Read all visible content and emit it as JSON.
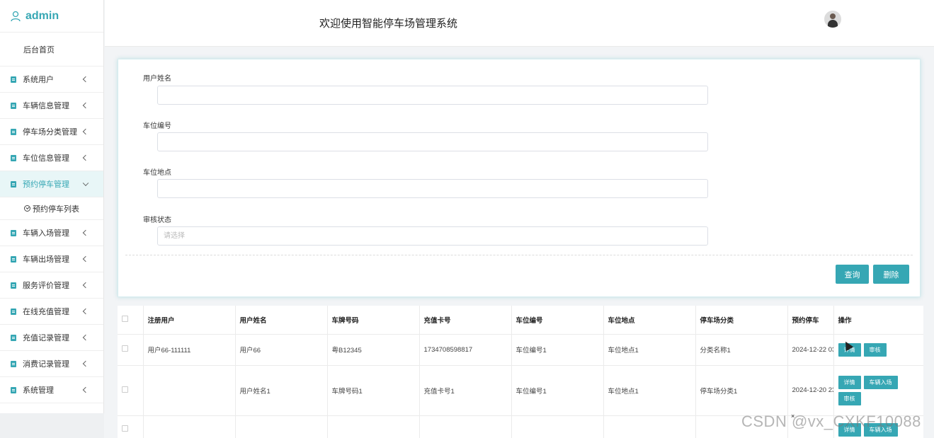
{
  "sidebar": {
    "brand": "admin",
    "home": "后台首页",
    "items": [
      {
        "label": "系统用户"
      },
      {
        "label": "车辆信息管理"
      },
      {
        "label": "停车场分类管理"
      },
      {
        "label": "车位信息管理"
      },
      {
        "label": "预约停车管理"
      },
      {
        "label": "车辆入场管理"
      },
      {
        "label": "车辆出场管理"
      },
      {
        "label": "服务评价管理"
      },
      {
        "label": "在线充值管理"
      },
      {
        "label": "充值记录管理"
      },
      {
        "label": "消费记录管理"
      },
      {
        "label": "系统管理"
      }
    ],
    "active_sub": "预约停车列表",
    "accent": "#36a7b4"
  },
  "header": {
    "welcome": "欢迎使用智能停车场管理系统"
  },
  "search": {
    "fields": [
      {
        "label": "用户姓名",
        "value": "",
        "placeholder": ""
      },
      {
        "label": "车位编号",
        "value": "",
        "placeholder": ""
      },
      {
        "label": "车位地点",
        "value": "",
        "placeholder": ""
      },
      {
        "label": "审核状态",
        "value": "",
        "placeholder": "请选择"
      }
    ],
    "query_button": "查询",
    "delete_button": "删除"
  },
  "table": {
    "columns": [
      "注册用户",
      "用户姓名",
      "车牌号码",
      "充值卡号",
      "车位编号",
      "车位地点",
      "停车场分类",
      "预约停车",
      "操作"
    ],
    "rows": [
      {
        "reg_user": "用户66-111111",
        "name": "用户66",
        "plate": "粤B12345",
        "card": "1734708598817",
        "spot_no": "车位编号1",
        "spot_loc": "车位地点1",
        "category": "分类名称1",
        "time": "2024-12-22 03"
      },
      {
        "reg_user": "",
        "name": "用户姓名1",
        "plate": "车牌号码1",
        "card": "充值卡号1",
        "spot_no": "车位编号1",
        "spot_loc": "车位地点1",
        "category": "停车场分类1",
        "time": "2024-12-20 23"
      },
      {
        "reg_user": "",
        "name": "",
        "plate": "",
        "card": "",
        "spot_no": "",
        "spot_loc": "",
        "category": "",
        "time": ""
      }
    ],
    "ops": {
      "detail": "详情",
      "audit": "审核",
      "enter": "车辆入场"
    }
  },
  "watermark": "CSDN @vx_CXKF10088"
}
